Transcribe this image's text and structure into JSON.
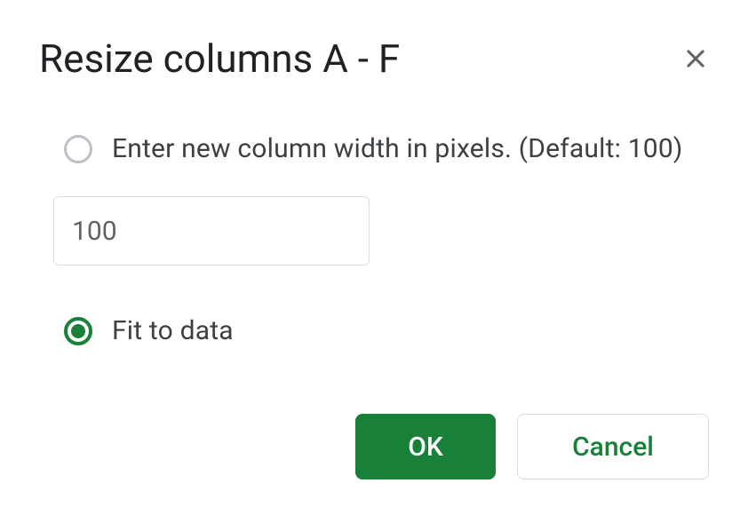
{
  "dialog": {
    "title": "Resize columns A - F",
    "options": {
      "enter_width": {
        "label": "Enter new column width in pixels. (Default: 100)",
        "selected": false
      },
      "fit_to_data": {
        "label": "Fit to data",
        "selected": true
      }
    },
    "input": {
      "value": "100"
    },
    "buttons": {
      "ok": "OK",
      "cancel": "Cancel"
    }
  }
}
